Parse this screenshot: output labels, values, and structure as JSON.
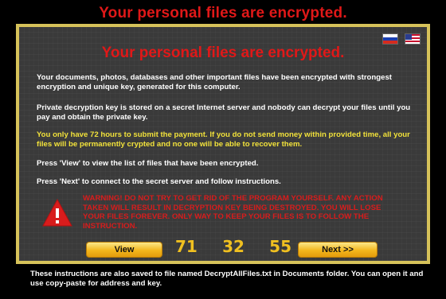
{
  "header": {
    "title": "Your personal files are encrypted."
  },
  "panel": {
    "title": "Your personal files are encrypted.",
    "flags": [
      "russia-flag-icon",
      "usa-flag-icon"
    ],
    "paragraphs": [
      "Your documents, photos, databases and other important files have been encrypted with strongest encryption and unique key, generated for this computer.",
      "Private decryption key is stored on a secret Internet server and nobody can decrypt your files until you pay and obtain the private key.",
      "You only have 72 hours to submit the payment. If you do not send money within provided time, all your files will be permanently crypted and no one will be able to recover them.",
      "Press 'View' to view the list of files that have been encrypted.",
      "Press 'Next' to connect to the secret server and follow instructions."
    ],
    "warning": "WARNING! DO NOT TRY TO GET RID OF THE PROGRAM YOURSELF. ANY ACTION TAKEN WILL RESULT IN DECRYPTION KEY BEING DESTROYED. YOU WILL LOSE YOUR FILES FOREVER. ONLY WAY TO KEEP YOUR FILES IS TO FOLLOW THE INSTRUCTION.",
    "view_label": "View",
    "next_label": "Next >>",
    "timer": {
      "hours": "71",
      "minutes": "32",
      "seconds": "55"
    }
  },
  "footer": {
    "text": "These instructions are also saved to file named DecryptAllFiles.txt in Documents folder. You can open it and use copy-paste for address and key."
  },
  "colors": {
    "title_red": "#e01818",
    "border_yellow": "#d6c25a",
    "panel_bg": "#3a3a3a",
    "highlight_yellow": "#f2e23a",
    "button_gold": "#f3b61c"
  }
}
